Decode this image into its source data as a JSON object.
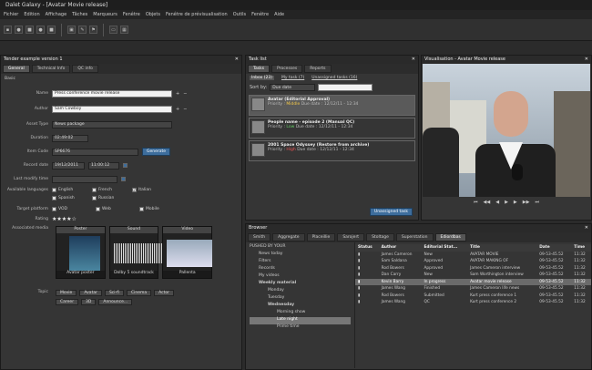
{
  "app": {
    "title": "Dalet Galaxy - [Avatar Movie release]"
  },
  "menu": [
    "Fichier",
    "Edition",
    "Affichage",
    "Tâches",
    "Marqueurs",
    "Fenêtre",
    "Objets",
    "Fenêtre de prévisualisation",
    "Outils",
    "Fenêtre",
    "Aide"
  ],
  "tender": {
    "title": "Tender example version 1",
    "tabs": [
      "General",
      "Technical Info",
      "QC info"
    ],
    "section": "Basic",
    "fields": {
      "name_label": "Name",
      "name": "Press conference movie release",
      "author_label": "Author",
      "author": "Sam Cowboy",
      "asset_label": "Asset Type",
      "asset": "News package",
      "duration_label": "Duration",
      "duration": "02:49:02",
      "item_label": "Item Code",
      "item": "SP6676",
      "generate": "Generate",
      "record_label": "Record date",
      "record_date": "19/12/2011",
      "record_time": "11:00:12",
      "lastmod_label": "Last modify time",
      "lastmod": "",
      "lang_label": "Available languages",
      "target_label": "Target platform",
      "rating_label": "Rating",
      "assoc_label": "Associated media",
      "topic_label": "Topic"
    },
    "languages": [
      {
        "name": "English",
        "checked": false
      },
      {
        "name": "French",
        "checked": false
      },
      {
        "name": "Italian",
        "checked": true
      },
      {
        "name": "Spanish",
        "checked": false
      },
      {
        "name": "Russian",
        "checked": false
      }
    ],
    "platforms": [
      "VOD",
      "Web",
      "Mobile"
    ],
    "rating_stars": "★★★★☆",
    "media": [
      {
        "head": "Poster",
        "cap": "Avatar poster"
      },
      {
        "head": "Sound",
        "cap": "Dolby 5 soundtrack"
      },
      {
        "head": "Video",
        "cap": "Pallenta"
      }
    ],
    "topics": [
      "Movie",
      "Avatar",
      "Sci-fi",
      "Cinema",
      "Actor",
      "Career",
      "3D",
      "Announce..."
    ]
  },
  "task": {
    "title": "Task list",
    "tabs": [
      "Tasks",
      "Processes",
      "Reports"
    ],
    "subtabs": [
      "Inbox (23)",
      "My task (7)",
      "Unassigned tasks (16)"
    ],
    "sort_label": "Sort by:",
    "sort": "Due date",
    "items": [
      {
        "title": "Avatar (Editorial Approval)",
        "priority": "Priority :",
        "prio": "Middle",
        "due": "Due date : 12/12/11 - 12:34"
      },
      {
        "title": "People name - episode 2 (Manual QC)",
        "priority": "Priority :",
        "prio": "Low",
        "due": "Due date : 12/12/11 - 12:34"
      },
      {
        "title": "2001 Space Odyssey (Restore from archive)",
        "priority": "Priority :",
        "prio": "High",
        "due": "Due date : 12/12/11 - 12:34"
      }
    ],
    "unassign": "Unassigned task"
  },
  "video": {
    "title": "Visualisation - Avatar Movie release"
  },
  "browser": {
    "title": "Browser",
    "tabs": [
      "Smith",
      "Aggregate",
      "Placeillie",
      "Sarojert",
      "Stoltage",
      "Superstation",
      "Ediordbas"
    ],
    "tree": [
      "PUSHED BY YOUR",
      "News today",
      "Filters",
      "Records",
      "My videos",
      "Weekly material",
      "Monday",
      "Tuesday",
      "Wednesday",
      "Morning show",
      "Late night",
      "Prime time"
    ],
    "headers": [
      "Status",
      "Author",
      "Editorial Stat...",
      "Title",
      "Date",
      "Time"
    ],
    "rows": [
      [
        "",
        "James Cameron",
        "New",
        "AVATAR MOVIE",
        "09-53-45.52",
        "11:32"
      ],
      [
        "",
        "Sam Saldana",
        "Approved",
        "AVATAR MAKING OF",
        "09-53-45.52",
        "11:32"
      ],
      [
        "",
        "Rod Bowers",
        "Approved",
        "James Cameron interview",
        "09-53-45.52",
        "11:32"
      ],
      [
        "",
        "Dan Carry",
        "New",
        "Sam Worthington interview",
        "09-53-45.52",
        "11:32"
      ],
      [
        "",
        "Kevin Barry",
        "In progress",
        "Avatar movie release",
        "09-53-45.52",
        "11:32"
      ],
      [
        "",
        "James Wang",
        "Finished",
        "James Cameron life news",
        "09-53-45.52",
        "11:32"
      ],
      [
        "",
        "Rod Bowers",
        "Submitted",
        "Kurt press conference 1",
        "09-53-45.52",
        "11:32"
      ],
      [
        "",
        "James Wang",
        "QC",
        "Kurt press conference 2",
        "09-53-45.52",
        "11:32"
      ]
    ]
  }
}
